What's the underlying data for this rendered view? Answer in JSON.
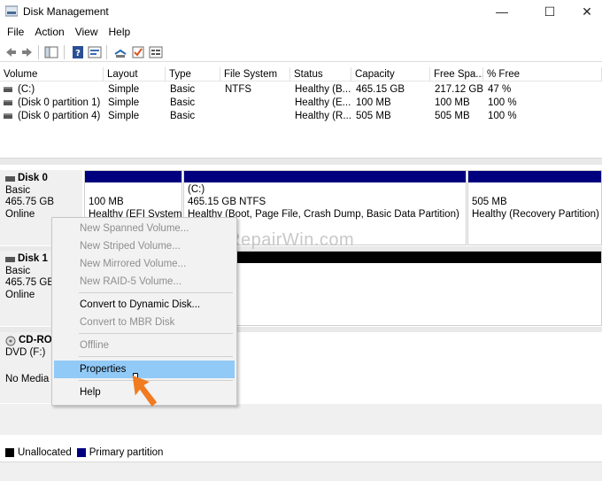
{
  "window": {
    "title": "Disk Management",
    "minimize": "—",
    "maximize": "☐",
    "close": "✕"
  },
  "menu": [
    "File",
    "Action",
    "View",
    "Help"
  ],
  "toolbar": [
    "back-icon",
    "forward-icon",
    "console-tree-icon",
    "help-icon",
    "properties-icon",
    "rescan-icon",
    "check-icon",
    "list-view-icon"
  ],
  "volume_list": {
    "columns": [
      "Volume",
      "Layout",
      "Type",
      "File System",
      "Status",
      "Capacity",
      "Free Spa...",
      "% Free"
    ],
    "rows": [
      [
        "(C:)",
        "Simple",
        "Basic",
        "NTFS",
        "Healthy (B...",
        "465.15 GB",
        "217.12 GB",
        "47 %"
      ],
      [
        "(Disk 0 partition 1)",
        "Simple",
        "Basic",
        "",
        "Healthy (E...",
        "100 MB",
        "100 MB",
        "100 %"
      ],
      [
        "(Disk 0 partition 4)",
        "Simple",
        "Basic",
        "",
        "Healthy (R...",
        "505 MB",
        "505 MB",
        "100 %"
      ]
    ]
  },
  "disks": {
    "disk0": {
      "name": "Disk 0",
      "type": "Basic",
      "size": "465.75 GB",
      "status": "Online",
      "partitions": [
        {
          "size": "100 MB",
          "status": "Healthy (EFI System"
        },
        {
          "name": "(C:)",
          "size": "465.15 GB NTFS",
          "status": "Healthy (Boot, Page File, Crash Dump, Basic Data Partition)"
        },
        {
          "size": "505 MB",
          "status": "Healthy (Recovery Partition)"
        }
      ]
    },
    "disk1": {
      "name": "Disk 1",
      "type": "Basic",
      "size": "465.75 GB",
      "status": "Online"
    },
    "cdrom": {
      "name": "CD-RO",
      "drive": "DVD (F:)",
      "media": "No Media"
    }
  },
  "context_menu": {
    "items": [
      {
        "label": "New Spanned Volume...",
        "enabled": false
      },
      {
        "label": "New Striped Volume...",
        "enabled": false
      },
      {
        "label": "New Mirrored Volume...",
        "enabled": false
      },
      {
        "label": "New RAID-5 Volume...",
        "enabled": false
      },
      {
        "label": "Convert to Dynamic Disk...",
        "enabled": true
      },
      {
        "label": "Convert to MBR Disk",
        "enabled": false
      },
      {
        "label": "Offline",
        "enabled": false
      },
      {
        "label": "Properties",
        "enabled": true,
        "highlighted": true
      },
      {
        "label": "Help",
        "enabled": true
      }
    ]
  },
  "legend": [
    {
      "label": "Unallocated",
      "color": "#000000"
    },
    {
      "label": "Primary partition",
      "color": "#00007f"
    }
  ],
  "watermark": "RepairWin.com",
  "colors": {
    "primary_partition": "#00007f",
    "highlight": "#91c9f7",
    "arrow": "#f07b21"
  }
}
